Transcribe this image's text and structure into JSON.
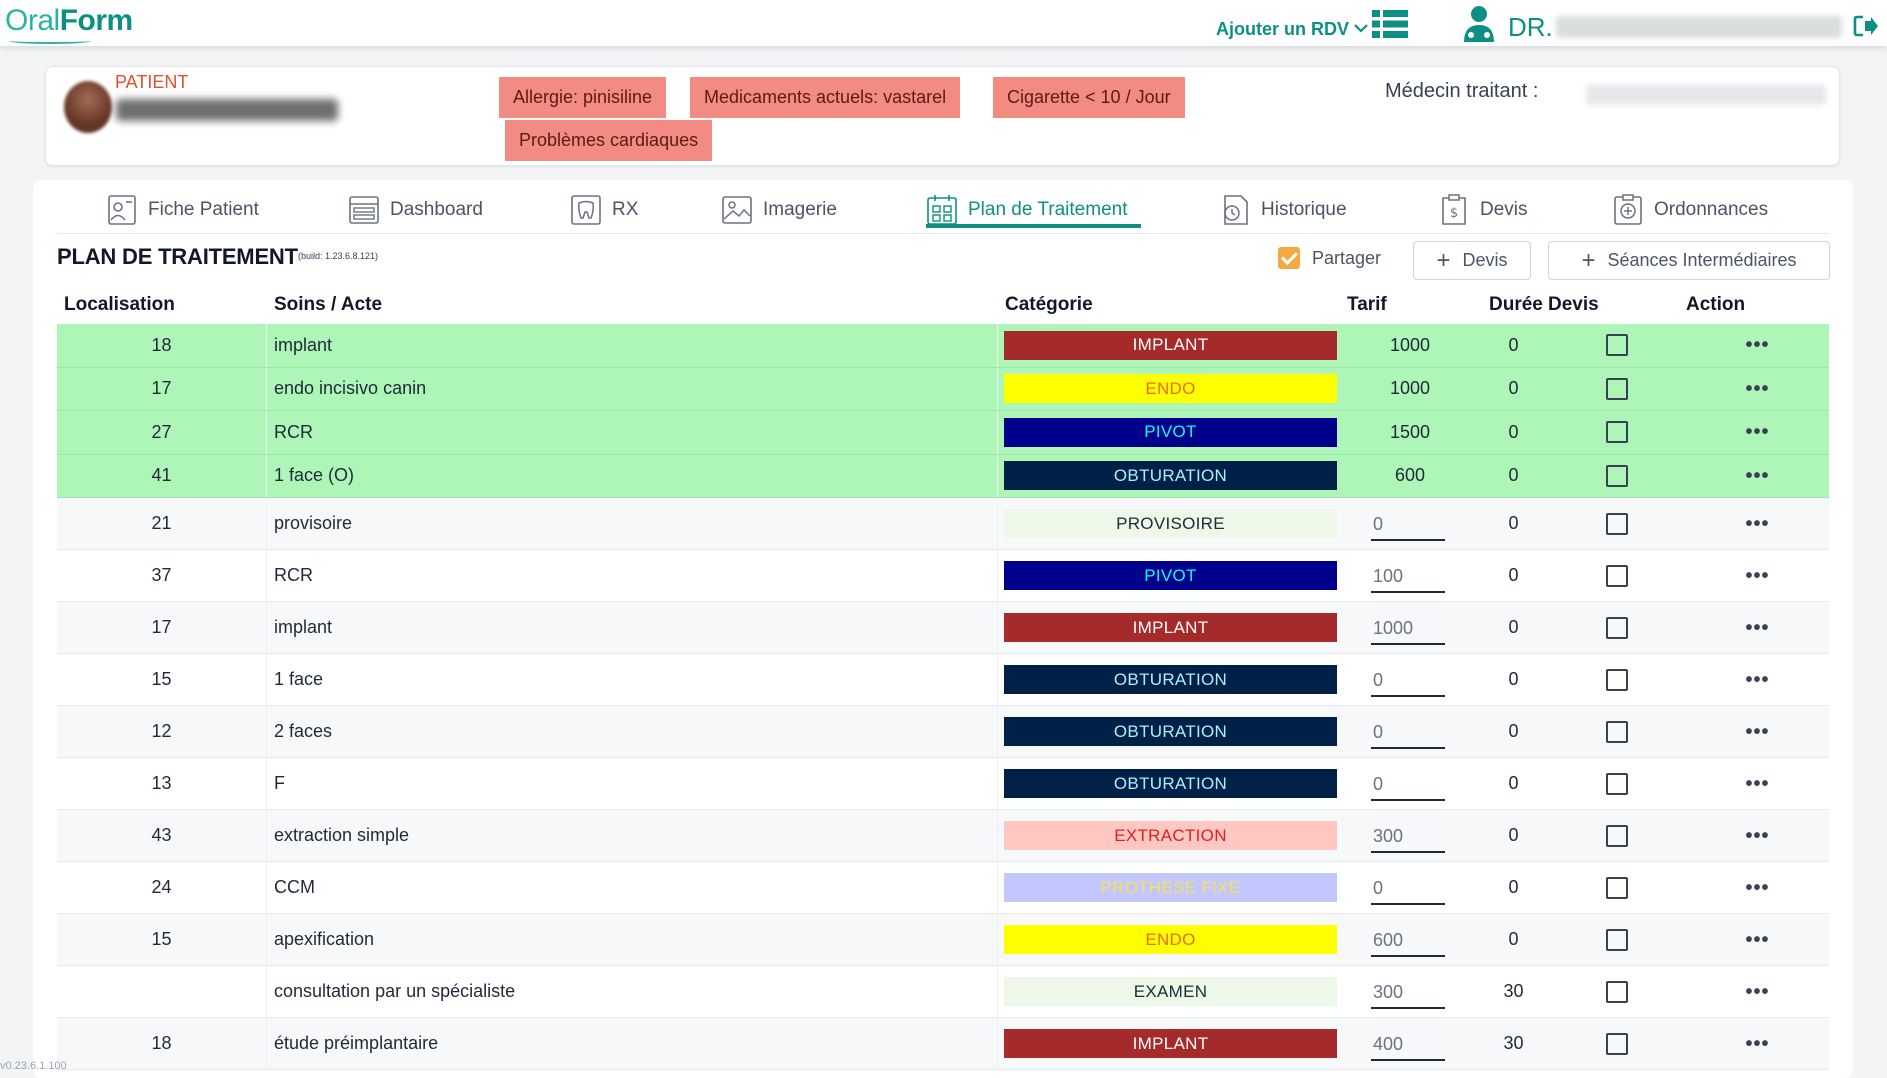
{
  "app": {
    "logo_oral": "Oral",
    "logo_form": "Form",
    "version": "v0.23.6.1.100"
  },
  "header": {
    "rdv_label": "Ajouter un RDV",
    "dr_label": "DR."
  },
  "patient": {
    "label": "PATIENT",
    "tags": [
      "Allergie: pinisiline",
      "Medicaments actuels: vastarel",
      "Cigarette < 10 / Jour",
      "Problèmes cardiaques"
    ],
    "medecin_label": "Médecin traitant :"
  },
  "tabs": [
    {
      "label": "Fiche Patient",
      "icon": "patient-file-icon"
    },
    {
      "label": "Dashboard",
      "icon": "dashboard-icon"
    },
    {
      "label": "RX",
      "icon": "tooth-icon"
    },
    {
      "label": "Imagerie",
      "icon": "image-icon"
    },
    {
      "label": "Plan de Traitement",
      "icon": "calendar-grid-icon",
      "active": true
    },
    {
      "label": "Historique",
      "icon": "history-icon"
    },
    {
      "label": "Devis",
      "icon": "devis-icon"
    },
    {
      "label": "Ordonnances",
      "icon": "prescription-icon"
    }
  ],
  "plan": {
    "title": "PLAN DE TRAITEMENT",
    "build": "(build: 1.23.6.8.121)",
    "partager_label": "Partager",
    "partager_checked": true,
    "devis_button": "Devis",
    "seances_button": "Séances Intermédiaires"
  },
  "table": {
    "headers": [
      "Localisation",
      "Soins / Acte",
      "Catégorie",
      "Tarif",
      "Durée",
      "Devis",
      "Action"
    ],
    "rows": [
      {
        "loc": "18",
        "soin": "implant",
        "cat": "IMPLANT",
        "tarif": "1000",
        "duree": "0",
        "done": true
      },
      {
        "loc": "17",
        "soin": "endo incisivo canin",
        "cat": "ENDO",
        "tarif": "1000",
        "duree": "0",
        "done": true
      },
      {
        "loc": "27",
        "soin": "RCR",
        "cat": "PIVOT",
        "tarif": "1500",
        "duree": "0",
        "done": true
      },
      {
        "loc": "41",
        "soin": "1 face (O)",
        "cat": "OBTURATION",
        "tarif": "600",
        "duree": "0",
        "done": true
      },
      {
        "loc": "21",
        "soin": "provisoire",
        "cat": "PROVISOIRE",
        "tarif": "0",
        "duree": "0",
        "done": false
      },
      {
        "loc": "37",
        "soin": "RCR",
        "cat": "PIVOT",
        "tarif": "100",
        "duree": "0",
        "done": false
      },
      {
        "loc": "17",
        "soin": "implant",
        "cat": "IMPLANT",
        "tarif": "1000",
        "duree": "0",
        "done": false
      },
      {
        "loc": "15",
        "soin": "1 face",
        "cat": "OBTURATION",
        "tarif": "0",
        "duree": "0",
        "done": false
      },
      {
        "loc": "12",
        "soin": "2 faces",
        "cat": "OBTURATION",
        "tarif": "0",
        "duree": "0",
        "done": false
      },
      {
        "loc": "13",
        "soin": "F",
        "cat": "OBTURATION",
        "tarif": "0",
        "duree": "0",
        "done": false
      },
      {
        "loc": "43",
        "soin": "extraction simple",
        "cat": "EXTRACTION",
        "tarif": "300",
        "duree": "0",
        "done": false
      },
      {
        "loc": "24",
        "soin": "CCM",
        "cat": "PROTHÈSE FIXE",
        "tarif": "0",
        "duree": "0",
        "done": false
      },
      {
        "loc": "15",
        "soin": "apexification",
        "cat": "ENDO",
        "tarif": "600",
        "duree": "0",
        "done": false
      },
      {
        "loc": "",
        "soin": "consultation par un spécialiste",
        "cat": "EXAMEN",
        "tarif": "300",
        "duree": "30",
        "done": false
      },
      {
        "loc": "18",
        "soin": "étude préimplantaire",
        "cat": "IMPLANT",
        "tarif": "400",
        "duree": "30",
        "done": false
      }
    ],
    "action_label": "•••"
  },
  "category_colors": {
    "IMPLANT": {
      "bg": "#a52a2a",
      "fg": "#ffffff"
    },
    "ENDO": {
      "bg": "#ffff00",
      "fg": "#e86b1c"
    },
    "PIVOT": {
      "bg": "#00008b",
      "fg": "#00ffff"
    },
    "OBTURATION": {
      "bg": "#002147",
      "fg": "#a8f0ff"
    },
    "PROVISOIRE": {
      "bg": "#eef8e9",
      "fg": "#1f2937"
    },
    "EXTRACTION": {
      "bg": "#ffc7c2",
      "fg": "#e01f1f"
    },
    "PROTHÈSE FIXE": {
      "bg": "#c2c7ff",
      "fg": "#f5e15a"
    },
    "EXAMEN": {
      "bg": "#eef8e9",
      "fg": "#1f2937"
    }
  },
  "colors": {
    "brand": "#0e8f83",
    "done_row": "#aef5b8",
    "tag_bg": "#f28b82",
    "checkbox_checked": "#f5a942"
  }
}
